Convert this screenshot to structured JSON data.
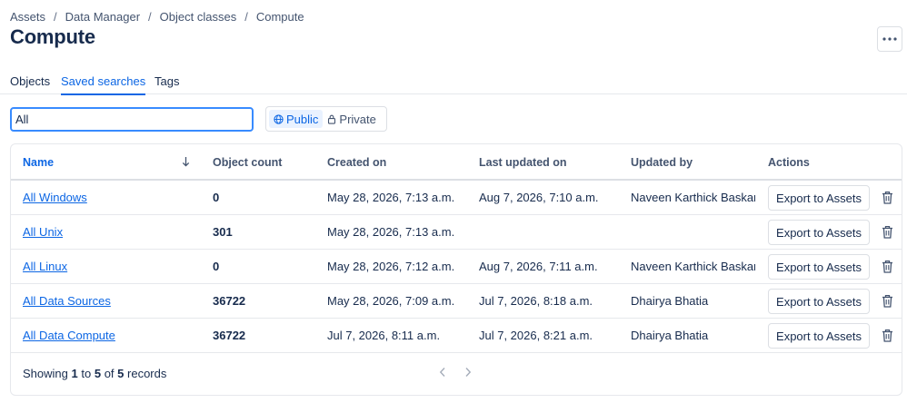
{
  "breadcrumb": [
    "Assets",
    "Data Manager",
    "Object classes",
    "Compute"
  ],
  "title": "Compute",
  "tabs": [
    "Objects",
    "Saved searches",
    "Tags"
  ],
  "active_tab": "Saved searches",
  "search": {
    "value": "All"
  },
  "visibility_toggle": {
    "options": [
      "Public",
      "Private"
    ],
    "selected": "Public"
  },
  "table": {
    "columns": [
      "Name",
      "Object count",
      "Created on",
      "Last updated on",
      "Updated by",
      "Actions"
    ],
    "rows": [
      {
        "name": "All Windows",
        "count": "0",
        "created": "May 28, 2026, 7:13 a.m.",
        "updated": "Aug 7, 2026, 7:10 a.m.",
        "updated_by": "Naveen Karthick Baskaran",
        "action": "Export to Assets"
      },
      {
        "name": "All Unix",
        "count": "301",
        "created": "May 28, 2026, 7:13 a.m.",
        "updated": "",
        "updated_by": "",
        "action": "Export to Assets"
      },
      {
        "name": "All Linux",
        "count": "0",
        "created": "May 28, 2026, 7:12 a.m.",
        "updated": "Aug 7, 2026, 7:11 a.m.",
        "updated_by": "Naveen Karthick Baskaran",
        "action": "Export to Assets"
      },
      {
        "name": "All Data Sources",
        "count": "36722",
        "created": "May 28, 2026, 7:09 a.m.",
        "updated": "Jul 7, 2026, 8:18 a.m.",
        "updated_by": "Dhairya Bhatia",
        "action": "Export to Assets"
      },
      {
        "name": "All Data Compute",
        "count": "36722",
        "created": "Jul 7, 2026, 8:11 a.m.",
        "updated": "Jul 7, 2026, 8:21 a.m.",
        "updated_by": "Dhairya Bhatia",
        "action": "Export to Assets"
      }
    ]
  },
  "footer": {
    "prefix": "Showing",
    "from": "1",
    "to_word": "to",
    "to": "5",
    "of_word": "of",
    "total": "5",
    "suffix": "records"
  },
  "icons": {
    "more": "more-horizontal-icon",
    "sort": "arrow-down-icon",
    "delete": "trash-icon",
    "public": "globe-icon",
    "private": "lock-icon",
    "prev": "chevron-left-icon",
    "next": "chevron-right-icon"
  },
  "colors": {
    "accent": "#0c66e4",
    "text": "#172b4d",
    "muted": "#44546f",
    "border": "#dcdfe4"
  }
}
